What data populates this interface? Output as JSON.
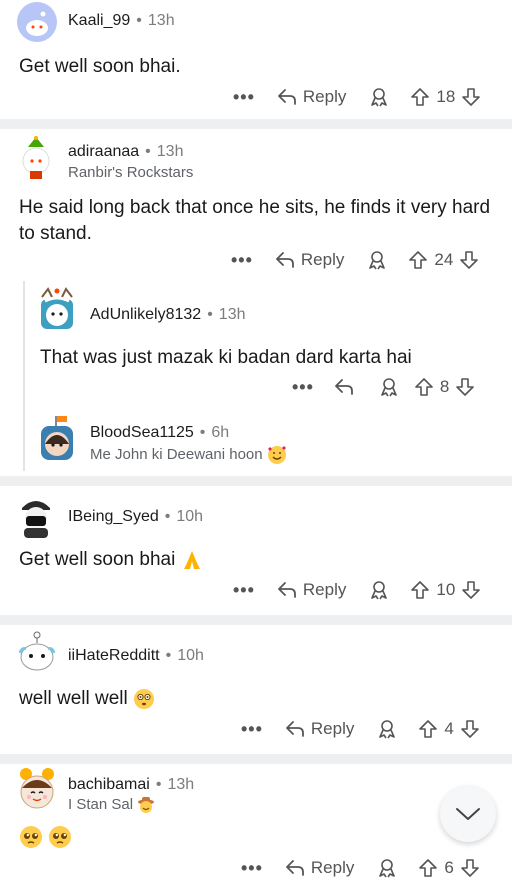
{
  "comments": [
    {
      "user": "Kaali_99",
      "time": "13h",
      "body": "Get well soon bhai.",
      "reply_label": "Reply",
      "votes": "18"
    },
    {
      "user": "adiraanaa",
      "time": "13h",
      "flair": "Ranbir's Rockstars",
      "body": "He said long back that once he sits, he finds it very hard to stand.",
      "reply_label": "Reply",
      "votes": "24"
    },
    {
      "user": "AdUnlikely8132",
      "time": "13h",
      "body": "That was just mazak ki badan dard karta hai",
      "votes": "8"
    },
    {
      "user": "BloodSea1125",
      "time": "6h",
      "flair": "Me John ki Deewani hoon"
    },
    {
      "user": "IBeing_Syed",
      "time": "10h",
      "body": "Get well soon bhai",
      "reply_label": "Reply",
      "votes": "10"
    },
    {
      "user": "iiHateRedditt",
      "time": "10h",
      "body": "well well well",
      "reply_label": "Reply",
      "votes": "4"
    },
    {
      "user": "bachibamai",
      "time": "13h",
      "flair": "I Stan Sal",
      "reply_label": "Reply",
      "votes": "6"
    }
  ],
  "colors": {
    "separator": "#edeff1",
    "muted": "#7c7c7c",
    "text": "#1a1a1b"
  }
}
